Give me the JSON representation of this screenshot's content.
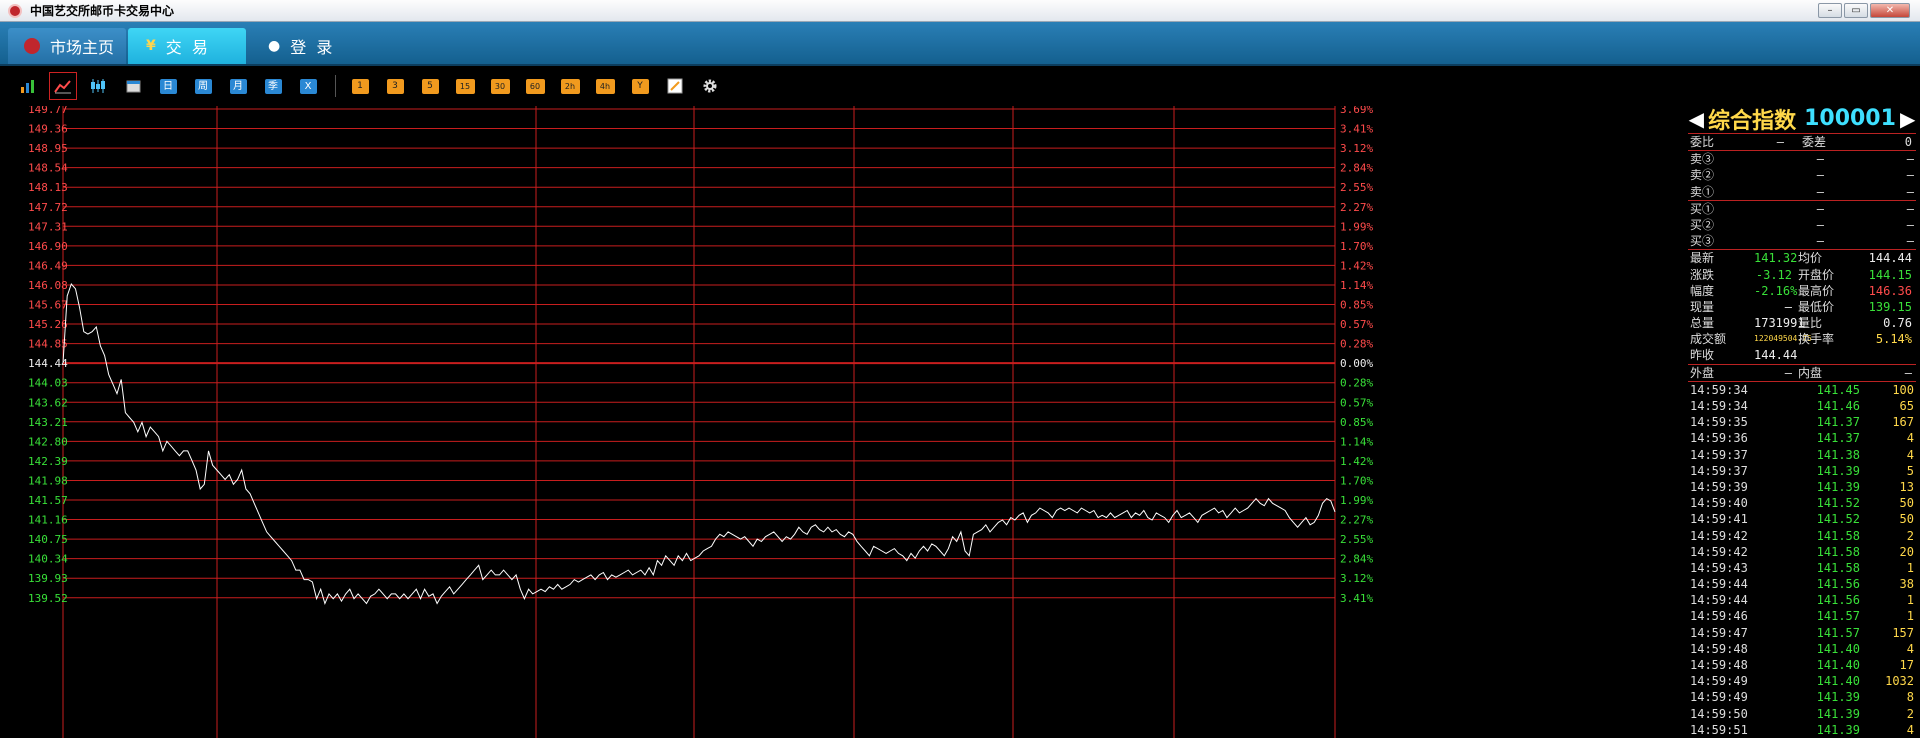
{
  "window": {
    "title": "中国艺交所邮币卡交易中心",
    "controls": [
      "–",
      "▭",
      "✕"
    ]
  },
  "nav": {
    "home_label": "市场主页",
    "trade_label": "交  易",
    "trade_icon": "¥",
    "login_label": "登  录"
  },
  "toolbar": {
    "periods": [
      "日",
      "周",
      "月",
      "季",
      "X"
    ],
    "minutes": [
      "1",
      "3",
      "5",
      "15",
      "30",
      "60",
      "2h",
      "4h",
      "Y"
    ]
  },
  "chart_data": {
    "type": "line",
    "series": [
      {
        "values": [
          144.44,
          145.85,
          146.1,
          146.0,
          145.6,
          145.1,
          145.05,
          145.1,
          145.2,
          144.8,
          144.6,
          144.2,
          144.0,
          143.8,
          144.1,
          143.4,
          143.3,
          143.2,
          143.0,
          143.2,
          142.9,
          143.1,
          143.0,
          142.9,
          142.6,
          142.8,
          142.7,
          142.6,
          142.5,
          142.6,
          142.6,
          142.4,
          142.2,
          141.8,
          141.9,
          142.6,
          142.3,
          142.2,
          142.1,
          142.0,
          142.1,
          141.9,
          142.0,
          142.2,
          141.8,
          141.7,
          141.5,
          141.3,
          141.1,
          140.9,
          140.8,
          140.7,
          140.6,
          140.5,
          140.4,
          140.3,
          140.1,
          140.1,
          139.9,
          139.9,
          139.85,
          139.5,
          139.7,
          139.4,
          139.6,
          139.5,
          139.6,
          139.45,
          139.6,
          139.7,
          139.5,
          139.6,
          139.5,
          139.4,
          139.55,
          139.6,
          139.7,
          139.6,
          139.5,
          139.6,
          139.6,
          139.5,
          139.6,
          139.5,
          139.6,
          139.7,
          139.5,
          139.7,
          139.55,
          139.6,
          139.4,
          139.55,
          139.65,
          139.75,
          139.6,
          139.7,
          139.8,
          139.9,
          140.0,
          140.1,
          140.2,
          139.9,
          140.0,
          140.1,
          140.0,
          140.0,
          140.1,
          140.0,
          139.9,
          140.0,
          139.7,
          139.5,
          139.7,
          139.6,
          139.65,
          139.7,
          139.65,
          139.75,
          139.7,
          139.8,
          139.7,
          139.75,
          139.8,
          139.9,
          139.85,
          139.9,
          139.95,
          140.0,
          139.9,
          140.0,
          140.05,
          139.9,
          140.0,
          139.95,
          140.0,
          140.05,
          140.1,
          140.0,
          140.05,
          140.1,
          140.0,
          140.15,
          140.0,
          140.3,
          140.2,
          140.4,
          140.3,
          140.2,
          140.4,
          140.3,
          140.45,
          140.3,
          140.35,
          140.4,
          140.5,
          140.55,
          140.6,
          140.75,
          140.85,
          140.8,
          140.9,
          140.85,
          140.8,
          140.75,
          140.8,
          140.7,
          140.6,
          140.75,
          140.7,
          140.8,
          140.85,
          140.9,
          140.8,
          140.7,
          140.8,
          140.75,
          140.85,
          141.0,
          140.9,
          140.85,
          141.0,
          141.05,
          140.95,
          140.9,
          141.0,
          140.9,
          140.95,
          140.85,
          140.8,
          140.9,
          140.85,
          140.7,
          140.6,
          140.5,
          140.4,
          140.6,
          140.55,
          140.5,
          140.45,
          140.5,
          140.55,
          140.45,
          140.4,
          140.3,
          140.45,
          140.35,
          140.5,
          140.6,
          140.5,
          140.65,
          140.6,
          140.5,
          140.4,
          140.55,
          140.8,
          140.7,
          140.9,
          140.5,
          140.4,
          140.85,
          140.9,
          140.95,
          141.05,
          140.9,
          141.0,
          141.1,
          141.15,
          141.05,
          141.2,
          141.15,
          141.25,
          141.3,
          141.1,
          141.25,
          141.3,
          141.4,
          141.35,
          141.3,
          141.2,
          141.35,
          141.4,
          141.35,
          141.4,
          141.35,
          141.3,
          141.4,
          141.35,
          141.3,
          141.35,
          141.2,
          141.25,
          141.2,
          141.3,
          141.2,
          141.25,
          141.3,
          141.35,
          141.2,
          141.3,
          141.25,
          141.35,
          141.2,
          141.15,
          141.3,
          141.25,
          141.2,
          141.1,
          141.25,
          141.35,
          141.2,
          141.25,
          141.3,
          141.2,
          141.1,
          141.25,
          141.3,
          141.35,
          141.4,
          141.3,
          141.35,
          141.2,
          141.3,
          141.4,
          141.3,
          141.35,
          141.4,
          141.5,
          141.6,
          141.5,
          141.45,
          141.6,
          141.5,
          141.45,
          141.4,
          141.35,
          141.2,
          141.1,
          141.0,
          141.1,
          141.2,
          141.05,
          141.1,
          141.25,
          141.5,
          141.6,
          141.55,
          141.32
        ]
      }
    ],
    "y_left_ticks": [
      "149.77",
      "149.36",
      "148.95",
      "148.54",
      "148.13",
      "147.72",
      "147.31",
      "146.90",
      "146.49",
      "146.08",
      "145.67",
      "145.26",
      "144.85",
      "144.44",
      "144.03",
      "143.62",
      "143.21",
      "142.80",
      "142.39",
      "141.98",
      "141.57",
      "141.16",
      "140.75",
      "140.34",
      "139.93",
      "139.52"
    ],
    "y_right_ticks": [
      "3.69%",
      "3.41%",
      "3.12%",
      "2.84%",
      "2.55%",
      "2.27%",
      "1.99%",
      "1.70%",
      "1.42%",
      "1.14%",
      "0.85%",
      "0.57%",
      "0.28%",
      "0.00%",
      "0.28%",
      "0.57%",
      "0.85%",
      "1.14%",
      "1.42%",
      "1.70%",
      "1.99%",
      "2.27%",
      "2.55%",
      "2.84%",
      "3.12%",
      "3.41%"
    ],
    "ylim": [
      139.52,
      149.77
    ],
    "prev_close": 144.44,
    "grid": true,
    "grid_color": "#c81e1e",
    "line_color": "#ffffff",
    "up_color": "#ff4b4b",
    "down_color": "#39e039"
  },
  "panel": {
    "name": "综合指数",
    "code": "100001",
    "webi_label": "委比",
    "webi_value": "—",
    "weicha_label": "委差",
    "weicha_value": "0",
    "sells": [
      {
        "label": "卖③",
        "price": "—",
        "vol": "—"
      },
      {
        "label": "卖②",
        "price": "—",
        "vol": "—"
      },
      {
        "label": "卖①",
        "price": "—",
        "vol": "—"
      }
    ],
    "buys": [
      {
        "label": "买①",
        "price": "—",
        "vol": "—"
      },
      {
        "label": "买②",
        "price": "—",
        "vol": "—"
      },
      {
        "label": "买③",
        "price": "—",
        "vol": "—"
      }
    ],
    "stats": [
      {
        "l1": "最新",
        "v1": "141.32",
        "c1": "green",
        "l2": "均价",
        "v2": "144.44",
        "c2": "white"
      },
      {
        "l1": "涨跌",
        "v1": "-3.12",
        "c1": "green",
        "l2": "开盘价",
        "v2": "144.15",
        "c2": "green"
      },
      {
        "l1": "幅度",
        "v1": "-2.16%",
        "c1": "green",
        "l2": "最高价",
        "v2": "146.36",
        "c2": "red"
      },
      {
        "l1": "现量",
        "v1": "—",
        "c1": "white",
        "l2": "最低价",
        "v2": "139.15",
        "c2": "green"
      },
      {
        "l1": "总量",
        "v1": "1731991",
        "c1": "white",
        "l2": "量比",
        "v2": "0.76",
        "c2": "white"
      },
      {
        "l1": "成交额",
        "v1": "122049504.75",
        "c1": "yellow",
        "l2": "换手率",
        "v2": "5.14%",
        "c2": "yellow"
      },
      {
        "l1": "昨收",
        "v1": "144.44",
        "c1": "white",
        "l2": "",
        "v2": "",
        "c2": "white"
      }
    ],
    "waipan_label": "外盘",
    "waipan_value": "—",
    "neipan_label": "内盘",
    "neipan_value": "—",
    "ticks": [
      [
        "14:59:34",
        "141.45",
        "100"
      ],
      [
        "14:59:34",
        "141.46",
        "65"
      ],
      [
        "14:59:35",
        "141.37",
        "167"
      ],
      [
        "14:59:36",
        "141.37",
        "4"
      ],
      [
        "14:59:37",
        "141.38",
        "4"
      ],
      [
        "14:59:37",
        "141.39",
        "5"
      ],
      [
        "14:59:39",
        "141.39",
        "13"
      ],
      [
        "14:59:40",
        "141.52",
        "50"
      ],
      [
        "14:59:41",
        "141.52",
        "50"
      ],
      [
        "14:59:42",
        "141.58",
        "2"
      ],
      [
        "14:59:42",
        "141.58",
        "20"
      ],
      [
        "14:59:43",
        "141.58",
        "1"
      ],
      [
        "14:59:44",
        "141.56",
        "38"
      ],
      [
        "14:59:44",
        "141.56",
        "1"
      ],
      [
        "14:59:46",
        "141.57",
        "1"
      ],
      [
        "14:59:47",
        "141.57",
        "157"
      ],
      [
        "14:59:48",
        "141.40",
        "4"
      ],
      [
        "14:59:48",
        "141.40",
        "17"
      ],
      [
        "14:59:49",
        "141.40",
        "1032"
      ],
      [
        "14:59:49",
        "141.39",
        "8"
      ],
      [
        "14:59:50",
        "141.39",
        "2"
      ],
      [
        "14:59:51",
        "141.39",
        "4"
      ]
    ]
  }
}
